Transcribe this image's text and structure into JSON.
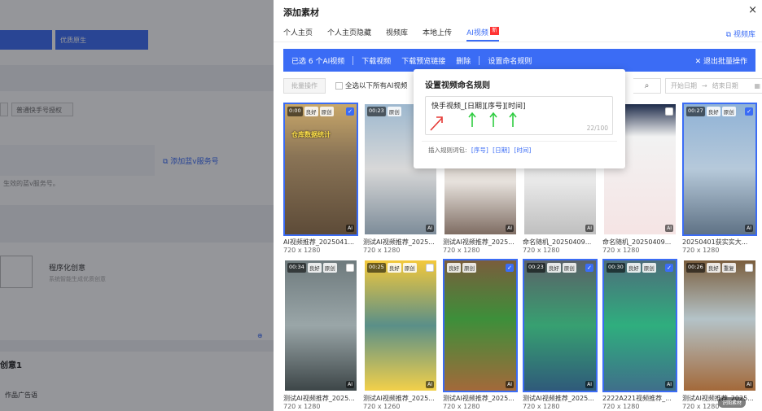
{
  "background": {
    "tab_label": "优质原生",
    "button_label": "普通快手号授权",
    "add_link": "添加蓝v服务号",
    "hint": "生效的蓝v服务号。",
    "program_title": "程序化创意",
    "program_sub": "系统智能生成优质创意",
    "idea_title": "创意1",
    "ad_label": "作品广告语"
  },
  "drawer": {
    "title": "添加素材",
    "close": "×",
    "tabs": [
      {
        "label": "个人主页"
      },
      {
        "label": "个人主页隐藏"
      },
      {
        "label": "视频库"
      },
      {
        "label": "本地上传"
      },
      {
        "label": "AI视频",
        "badge": "新"
      }
    ],
    "library_link": "视频库",
    "bulk": {
      "selected": "已选 6 个AI视频",
      "download": "下载视频",
      "download_link": "下载预览链接",
      "delete": "删除",
      "rename": "设置命名规则",
      "exit": "退出批量操作"
    },
    "toolbar": {
      "batch": "批量操作",
      "select_all": "全选以下所有AI视频",
      "start_date": "开始日期",
      "to": "→",
      "end_date": "结束日期"
    }
  },
  "popup": {
    "title": "设置视频命名规则",
    "value": "快手视频_[日期][序号][时间]",
    "count": "22/100",
    "insert_label": "插入规则词包:",
    "insert_tokens": [
      "[序号]",
      "[日期]",
      "[时间]"
    ]
  },
  "videos": [
    {
      "name": "AI视频推荐_2025041...",
      "size": "720 x 1280",
      "duration": "0:00",
      "tag1": "良好",
      "tag2": "原创",
      "overlay": "仓库数据统计",
      "selected": true
    },
    {
      "name": "测试AI视频推荐_2025...",
      "size": "720 x 1280",
      "duration": "00:23",
      "tag1": "原创",
      "tag2": "",
      "overlay": "",
      "selected": false
    },
    {
      "name": "测试AI视频推荐_2025...",
      "size": "720 x 1280",
      "duration": "",
      "tag1": "",
      "tag2": "",
      "overlay": "",
      "selected": false
    },
    {
      "name": "命名随机_20250409...",
      "size": "720 x 1280",
      "duration": "",
      "tag1": "",
      "tag2": "",
      "overlay": "",
      "selected": false
    },
    {
      "name": "命名随机_20250409...",
      "size": "720 x 1280",
      "duration": "",
      "tag1": "",
      "tag2": "",
      "overlay": "",
      "selected": false
    },
    {
      "name": "20250401获实实大...",
      "size": "720 x 1280",
      "duration": "00:27",
      "tag1": "良好",
      "tag2": "原创",
      "overlay": "",
      "selected": true
    },
    {
      "name": "测试AI视频推荐_2025...",
      "size": "720 x 1280",
      "duration": "00:34",
      "tag1": "良好",
      "tag2": "原创",
      "overlay": "",
      "selected": false
    },
    {
      "name": "测试AI视频推荐_2025...",
      "size": "720 x 1260",
      "duration": "00:25",
      "tag1": "良好",
      "tag2": "原创",
      "overlay": "",
      "selected": false
    },
    {
      "name": "测试AI视频推荐_2025...",
      "size": "720 x 1280",
      "duration": "",
      "tag1": "良好",
      "tag2": "原创",
      "overlay": "",
      "selected": true
    },
    {
      "name": "测试AI视频推荐_2025...",
      "size": "720 x 1280",
      "duration": "00:23",
      "tag1": "良好",
      "tag2": "原创",
      "overlay": "",
      "selected": true
    },
    {
      "name": "2222A221视频推荐_...",
      "size": "720 x 1280",
      "duration": "00:30",
      "tag1": "良好",
      "tag2": "原创",
      "overlay": "",
      "selected": true
    },
    {
      "name": "测试AI视频推荐_2025...",
      "size": "720 x 1280",
      "duration": "00:26",
      "tag1": "良好",
      "tag2": "重复",
      "overlay": "",
      "selected": false
    }
  ],
  "ai_tag": "AI",
  "watermark": "识图素材",
  "colors": {
    "accent": "#3b6cf5",
    "new_badge": "#ff3333"
  }
}
